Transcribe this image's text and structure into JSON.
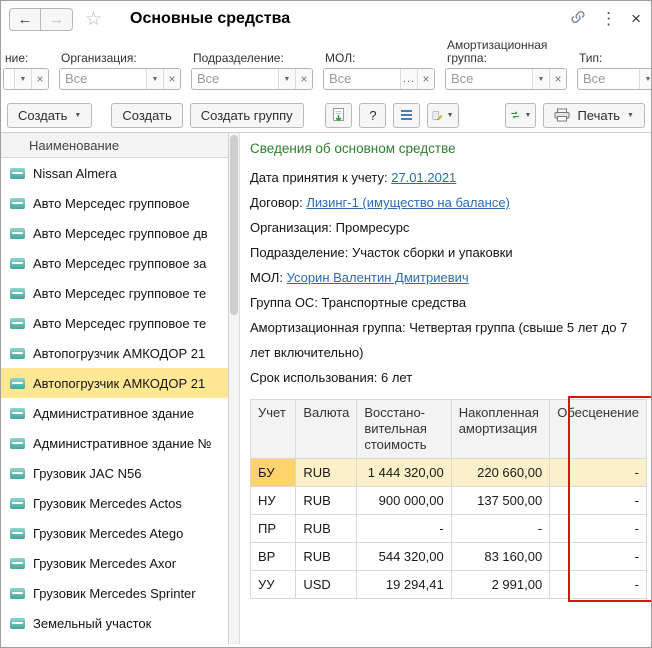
{
  "window": {
    "title": "Основные средства"
  },
  "icons": {
    "back": "←",
    "forward": "→",
    "star": "☆",
    "kebab": "⋮",
    "close": "×",
    "dropdown": "▼",
    "ellipsis": "...",
    "clear": "×",
    "help": "?"
  },
  "colors": {
    "link": "#2b6cb0",
    "heading_green": "#2e7d2e",
    "selection_yellow": "#ffe793",
    "cell_orange": "#ffd36b",
    "row_yellow": "#fbf0c9",
    "red_box": "#dd1111"
  },
  "filters": {
    "name": {
      "label": "ние:",
      "value": ""
    },
    "org": {
      "label": "Организация:",
      "value": "Все"
    },
    "dept": {
      "label": "Подразделение:",
      "value": "Все"
    },
    "mol": {
      "label": "МОЛ:",
      "value": "Все"
    },
    "amort": {
      "label": "Амортизационная группа:",
      "value": "Все"
    },
    "type": {
      "label": "Тип:",
      "value": "Все"
    }
  },
  "toolbar": {
    "create_menu": "Создать",
    "create": "Создать",
    "create_group": "Создать группу",
    "help": "?",
    "print": "Печать"
  },
  "list": {
    "header": "Наименование",
    "rows": [
      "Nissan Almera",
      "Авто Мерседес групповое",
      "Авто Мерседес групповое дв",
      "Авто Мерседес групповое за",
      "Авто Мерседес групповое те",
      "Авто Мерседес групповое те",
      "Автопогрузчик АМКОДОР 21",
      "Автопогрузчик АМКОДОР 21",
      "Административное здание",
      "Административное здание №",
      "Грузовик JAC N56",
      "Грузовик Mercedes Actos",
      "Грузовик Mercedes Atego",
      "Грузовик Mercedes Axor",
      "Грузовик Mercedes Sprinter",
      "Земельный участок"
    ]
  },
  "info": {
    "heading": "Сведения об основном средстве",
    "rows": [
      {
        "label": "Дата принятия к учету: ",
        "value": "27.01.2021"
      },
      {
        "label": "Договор: ",
        "value": "Лизинг-1 (имущество на балансе)"
      },
      {
        "label": "Организация: ",
        "value": "Промресурс"
      },
      {
        "label": "Подразделение: ",
        "value": "Участок сборки и упаковки"
      },
      {
        "label": "МОЛ: ",
        "value": "Усорин Валентин Дмитриевич"
      },
      {
        "label": "Группа ОС: ",
        "value": "Транспортные средства"
      },
      {
        "label": "Амортизационная группа: ",
        "value": "Четвертая группа (свыше 5 лет до 7 лет включительно)"
      },
      {
        "label": "Срок использования: ",
        "value": "6 лет"
      }
    ]
  },
  "table": {
    "headers": [
      "Учет",
      "Валюта",
      "Восстано-вительная стоимость",
      "Накопленная амортизация",
      "Обесценение"
    ],
    "rows": [
      [
        "БУ",
        "RUB",
        "1 444 320,00",
        "220 660,00",
        "-"
      ],
      [
        "НУ",
        "RUB",
        "900 000,00",
        "137 500,00",
        "-"
      ],
      [
        "ПР",
        "RUB",
        "-",
        "-",
        "-"
      ],
      [
        "ВР",
        "RUB",
        "544 320,00",
        "83 160,00",
        "-"
      ],
      [
        "УУ",
        "USD",
        "19 294,41",
        "2 991,00",
        "-"
      ]
    ]
  }
}
